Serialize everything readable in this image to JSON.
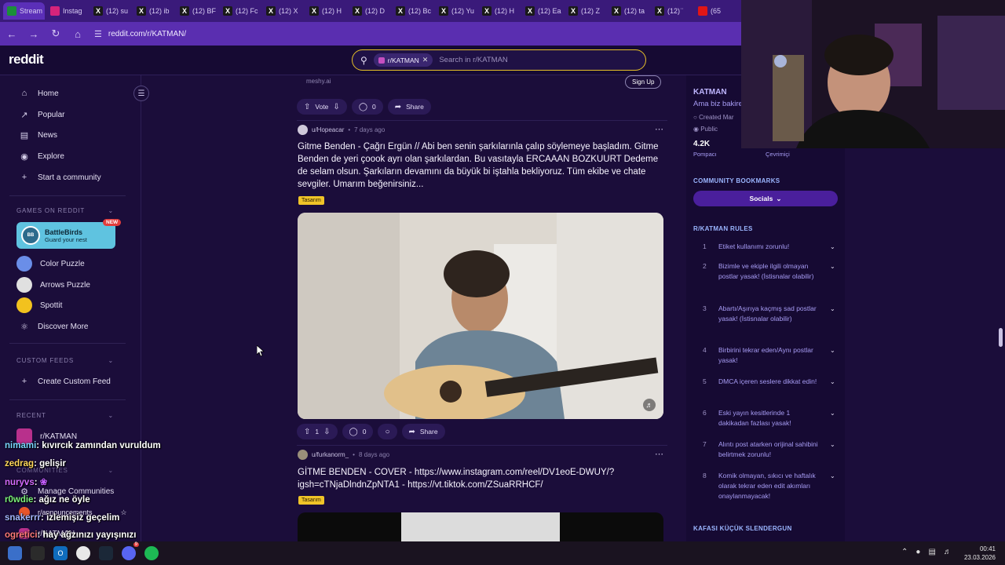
{
  "browser": {
    "tabs": [
      {
        "label": "Stream",
        "icon": "st"
      },
      {
        "label": "Instag",
        "icon": "ig"
      },
      {
        "label": "(12) su",
        "icon": "x"
      },
      {
        "label": "(12) ib",
        "icon": "x"
      },
      {
        "label": "(12) BF",
        "icon": "x"
      },
      {
        "label": "(12) Fc",
        "icon": "x"
      },
      {
        "label": "(12) X",
        "icon": "x"
      },
      {
        "label": "(12) H",
        "icon": "x"
      },
      {
        "label": "(12) D",
        "icon": "x"
      },
      {
        "label": "(12) Bc",
        "icon": "x"
      },
      {
        "label": "(12) Yu",
        "icon": "x"
      },
      {
        "label": "(12) H",
        "icon": "x"
      },
      {
        "label": "(12) Ea",
        "icon": "x"
      },
      {
        "label": "(12) Z",
        "icon": "x"
      },
      {
        "label": "(12) ta",
        "icon": "x"
      },
      {
        "label": "(12) ̈",
        "icon": "x"
      },
      {
        "label": "(65",
        "icon": "yt"
      }
    ],
    "url": "reddit.com/r/KATMAN/"
  },
  "header": {
    "logo": "reddit",
    "search_chip": "r/KATMAN",
    "search_placeholder": "Search in r/KATMAN"
  },
  "leftnav": {
    "items": [
      {
        "label": "Home",
        "icon": "home-icon"
      },
      {
        "label": "Popular",
        "icon": "popular-icon"
      },
      {
        "label": "News",
        "icon": "news-icon"
      },
      {
        "label": "Explore",
        "icon": "explore-icon"
      },
      {
        "label": "Start a community",
        "icon": "plus-icon"
      }
    ],
    "games_header": "GAMES ON REDDIT",
    "featured_game": {
      "title": "BattleBirds",
      "subtitle": "Guard your nest",
      "badge": "NEW"
    },
    "games": [
      {
        "label": "Color Puzzle"
      },
      {
        "label": "Arrows Puzzle"
      },
      {
        "label": "Spottit"
      },
      {
        "label": "Discover More"
      }
    ],
    "custom_feeds_header": "CUSTOM FEEDS",
    "create_feed": "Create Custom Feed",
    "recent_header": "RECENT",
    "recent_item": "r/KATMAN",
    "communities_header": "COMMUNITIES",
    "manage_communities": "Manage Communities",
    "announcements": "r/announcements",
    "katman_last": "r/KATMAN"
  },
  "chat": {
    "lines": [
      {
        "name": "nimami",
        "msg": ": kıvırcık zamından vuruldum"
      },
      {
        "name": "zedrag",
        "msg": ": gelişir"
      },
      {
        "name": "nuryvs",
        "msg": ":"
      },
      {
        "name": "r0wdie",
        "msg": ": ağız ne öyle"
      },
      {
        "name": "snakerrr",
        "msg": ": izlemişiz geçelim"
      },
      {
        "name": "ogretici",
        "msg": ": hay ağzınızı yayışınızı"
      }
    ]
  },
  "feed": {
    "ad": {
      "domain": "meshy.ai",
      "cta": "Sign Up"
    },
    "ad_actions": {
      "vote": "Vote",
      "comments": "0",
      "share": "Share"
    },
    "post1": {
      "author": "u/Hopeacar",
      "time": "7 days ago",
      "title": "Gitme Benden - Çağrı Ergün // Abi ben senin şarkılarınla çalıp söylemeye başladım. Gitme Benden de yeri çoook ayrı olan şarkılardan. Bu vasıtayla ERCAAAN BOZKUURT Dedeme de selam olsun. Şarkıların devamını da büyük bi iştahla bekliyoruz. Tüm ekibe ve chate sevgiler. Umarım beğenirsiniz...",
      "flair": "Tasarım",
      "votes": "1",
      "comments": "0",
      "share": "Share"
    },
    "post2": {
      "author": "u/furkanorm_",
      "time": "8 days ago",
      "title": "GİTME BENDEN - COVER - https://www.instagram.com/reel/DV1eoE-DWUY/?igsh=cTNjaDlndnZpNTA1 - https://vt.tiktok.com/ZSuaRRHCF/",
      "flair": "Tasarım"
    }
  },
  "sidebar": {
    "name": "KATMAN",
    "desc": "Ama biz bakire",
    "created": "Created Mar",
    "visibility": "Public",
    "members": "4.2K",
    "members_label": "Pompacı",
    "online_label": "Çevrimiçi",
    "bookmarks_header": "COMMUNITY BOOKMARKS",
    "socials": "Socials",
    "rules_header": "R/KATMAN RULES",
    "rules": [
      {
        "num": "1",
        "text": "Etiket kullanımı zorunlu!"
      },
      {
        "num": "2",
        "text": "Bizimle ve ekiple ilgili olmayan postlar yasak! (İstisnalar olabilir)"
      },
      {
        "num": "3",
        "text": "Abartı/Aşırıya kaçmış sad postlar yasak! (İstisnalar olabilir)"
      },
      {
        "num": "4",
        "text": "Birbirini tekrar eden/Aynı postlar yasak!"
      },
      {
        "num": "5",
        "text": "DMCA içeren seslere dikkat edin!"
      },
      {
        "num": "6",
        "text": "Eski yayın kesitlerinde 1 dakikadan fazlası yasak!"
      },
      {
        "num": "7",
        "text": "Alıntı post atarken orijinal sahibini belirtmek zorunlu!"
      },
      {
        "num": "8",
        "text": "Komik olmayan, sıkıcı ve haftalık olarak tekrar eden edit akımları onaylanmayacak!"
      }
    ],
    "footer_header": "KAFASI KÜÇÜK SLENDERGUN"
  },
  "taskbar": {
    "time": "00:41",
    "date": "23.03.2026",
    "discord_badge": "9"
  },
  "colors": {
    "accent": "#5a2eb0",
    "search_border": "#e7c128",
    "flair": "#f0c428"
  }
}
